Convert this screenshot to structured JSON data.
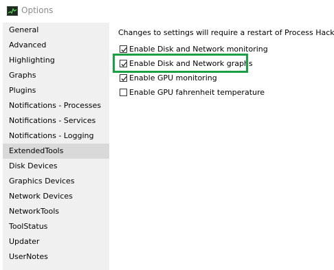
{
  "window": {
    "title": "Options",
    "icon": "process-hacker-icon"
  },
  "sidebar": {
    "items": [
      {
        "label": "General"
      },
      {
        "label": "Advanced"
      },
      {
        "label": "Highlighting"
      },
      {
        "label": "Graphs"
      },
      {
        "label": "Plugins"
      },
      {
        "label": "Notifications - Processes"
      },
      {
        "label": "Notifications - Services"
      },
      {
        "label": "Notifications - Logging"
      },
      {
        "label": "ExtendedTools",
        "selected": true
      },
      {
        "label": "Disk Devices"
      },
      {
        "label": "Graphics Devices"
      },
      {
        "label": "Network Devices"
      },
      {
        "label": "NetworkTools"
      },
      {
        "label": "ToolStatus"
      },
      {
        "label": "Updater"
      },
      {
        "label": "UserNotes"
      }
    ]
  },
  "main": {
    "notice": "Changes to settings will require a restart of Process Hacker.",
    "options": [
      {
        "label": "Enable Disk and Network monitoring",
        "checked": true
      },
      {
        "label": "Enable Disk and Network graphs",
        "checked": true,
        "highlighted": true
      },
      {
        "label": "Enable GPU monitoring",
        "checked": true
      },
      {
        "label": "Enable GPU fahrenheit temperature",
        "checked": false
      }
    ]
  },
  "colors": {
    "highlight": "#1aa043",
    "selected_item": "#d9d9d9",
    "sidebar_bg": "#f0f0f0"
  }
}
